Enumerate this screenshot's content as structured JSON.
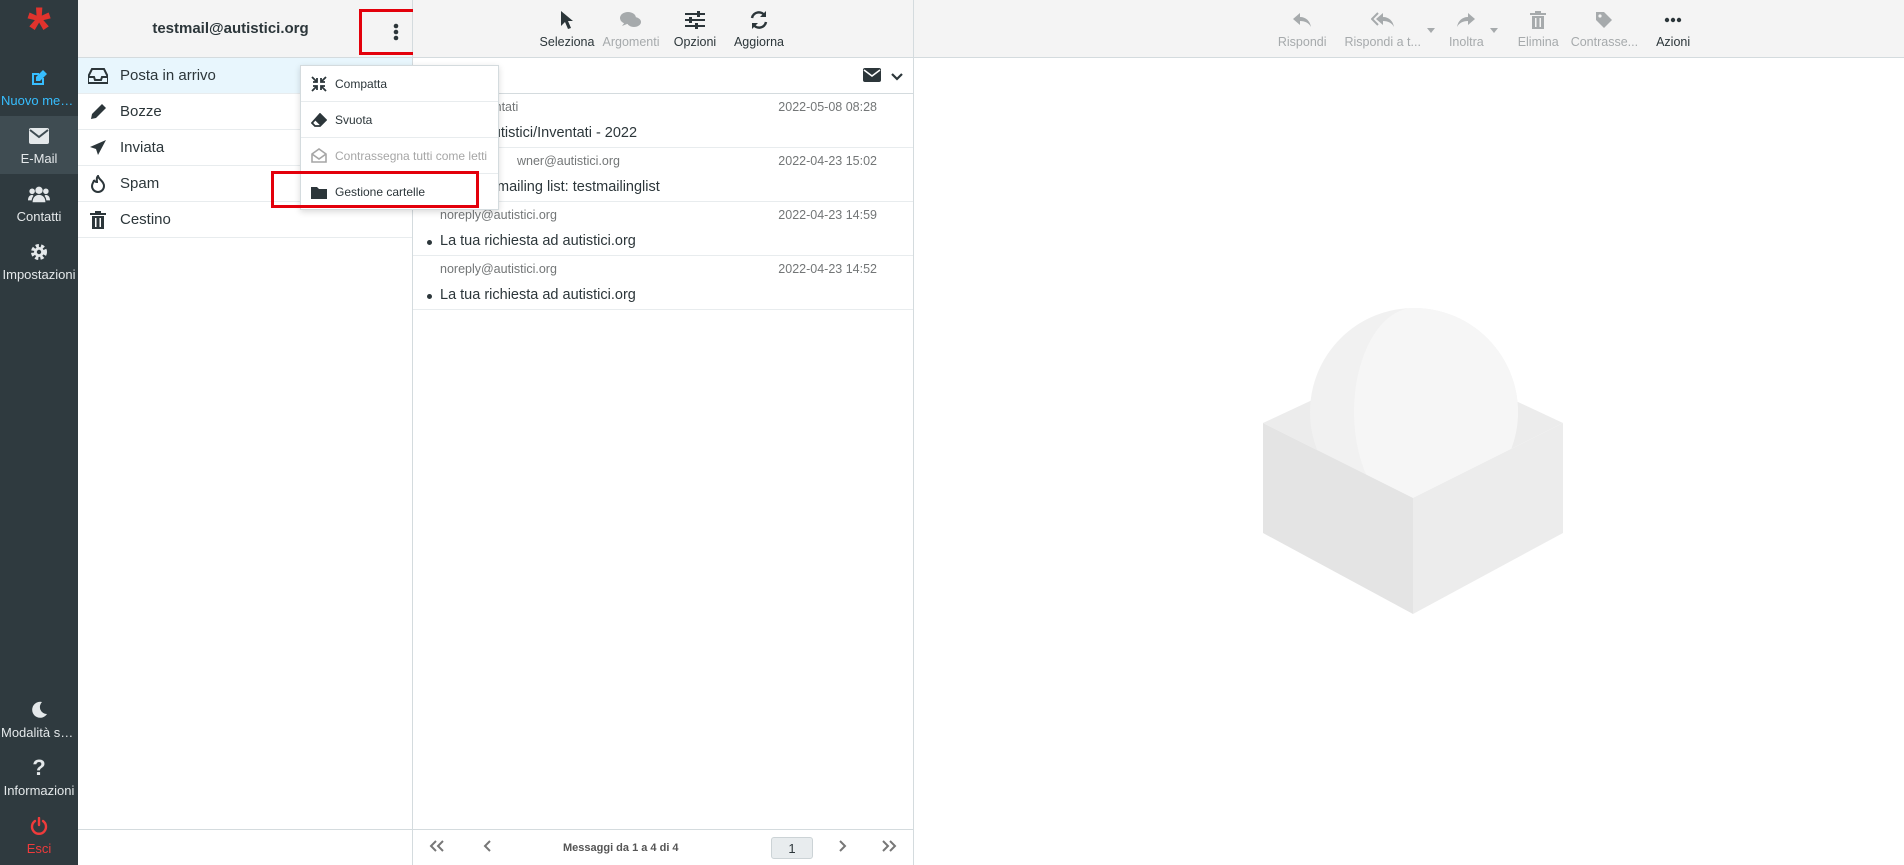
{
  "rail": {
    "compose_label": "Nuovo mes...",
    "mail_label": "E-Mail",
    "contacts_label": "Contatti",
    "settings_label": "Impostazioni",
    "darkmode_label": "Modalità sc...",
    "about_label": "Informazioni",
    "logout_label": "Esci"
  },
  "account": {
    "email": "testmail@autistici.org"
  },
  "folders": [
    {
      "label": "Posta in arrivo",
      "icon": "inbox-icon"
    },
    {
      "label": "Bozze",
      "icon": "pencil-icon"
    },
    {
      "label": "Inviata",
      "icon": "paper-plane-icon"
    },
    {
      "label": "Spam",
      "icon": "fire-icon"
    },
    {
      "label": "Cestino",
      "icon": "trash-icon"
    }
  ],
  "folder_menu": [
    {
      "label": "Compatta",
      "icon": "compress-icon"
    },
    {
      "label": "Svuota",
      "icon": "eraser-icon"
    },
    {
      "label": "Contrassegna tutti come letti",
      "icon": "envelope-open-icon"
    },
    {
      "label": "Gestione cartelle",
      "icon": "folder-icon"
    }
  ],
  "list_toolbar": {
    "select": "Seleziona",
    "threads": "Argomenti",
    "options": "Opzioni",
    "refresh": "Aggiorna"
  },
  "messages": [
    {
      "from": "Inventati",
      "date": "2022-05-08 08:28",
      "subject": "er Autistici/Inventati - 2022"
    },
    {
      "from": "wner@autistici.org",
      "date": "2022-04-23 15:02",
      "subject": "mailing list: testmailinglist"
    },
    {
      "from": "noreply@autistici.org",
      "date": "2022-04-23 14:59",
      "subject": "La tua richiesta ad autistici.org"
    },
    {
      "from": "noreply@autistici.org",
      "date": "2022-04-23 14:52",
      "subject": "La tua richiesta ad autistici.org"
    }
  ],
  "pagination": {
    "count_text": "Messaggi da 1 a 4 di 4",
    "page": "1"
  },
  "preview_toolbar": {
    "reply": "Rispondi",
    "reply_all": "Rispondi a t...",
    "forward": "Inoltra",
    "delete": "Elimina",
    "mark": "Contrasse...",
    "actions": "Azioni"
  },
  "colors": {
    "rail_bg": "#2f3a3f",
    "accent": "#37beff",
    "highlight": "#e3000b",
    "logo": "#e0332d"
  }
}
